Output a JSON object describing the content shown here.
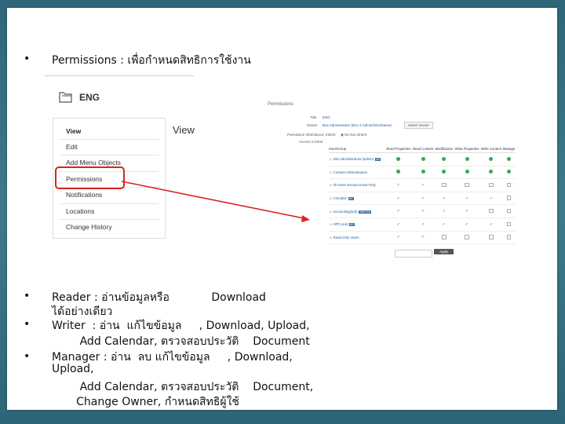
{
  "bullets": {
    "b1": "Permissions : เพื่อกำหนดสิทธิการใช้งาน",
    "b2_l1": "Reader : อ่านข้อมูลหรือ            Download",
    "b2_l2": "ได้อย่างเดียว",
    "b3_l1": "Writer  : อ่าน  แก้ไขข้อมูล     , Download, Upload,",
    "b3_l2": "        Add Calendar, ตรวจสอบประวัติ    Document",
    "b4_l1": "Manager : อ่าน  ลบ แก้ไขข้อมูล     , Download,",
    "b4_l2": "Upload,",
    "b4_l3": "        Add Calendar, ตรวจสอบประวัติ    Document,",
    "b4_l4": "       Change Owner, กำหนดสิทธิผู้ใช้"
  },
  "folder": {
    "name": "ENG"
  },
  "menu": {
    "title": "View",
    "items": [
      "Edit",
      "Add Menu Objects",
      "Permissions",
      "Notifications",
      "Locations",
      "Change History"
    ]
  },
  "view_heading": "View",
  "panel": {
    "title": "Permissions",
    "row1_label": "Title",
    "row1_value": "ENG",
    "row2_label": "Owner",
    "row2_value": "Box Administrator (Box 2 Admin/Shortname)",
    "row2_btn": "Select Owner",
    "row3_label": "Permission Inheritance",
    "row3_opt1": "Inherit",
    "row3_opt2": "Do Not Inherit",
    "row4_label": "Access Control",
    "columns": [
      "User/Group",
      "Read Properties",
      "Read Content",
      "Modification",
      "Write Properties",
      "Write Content",
      "Manage"
    ],
    "rows": [
      {
        "name": "Site Administrators (admin)",
        "tag": "AD",
        "cells": [
          "g",
          "g",
          "g",
          "g",
          "g",
          "g"
        ]
      },
      {
        "name": "Content Administrators",
        "tag": "",
        "cells": [
          "g",
          "g",
          "g",
          "g",
          "g",
          "g"
        ]
      },
      {
        "name": "All Users Except Guest-Only",
        "tag": "",
        "cells": [
          "t",
          "t",
          "b",
          "b",
          "b",
          "b"
        ]
      },
      {
        "name": "CSCabin",
        "tag": "AD",
        "cells": [
          "t",
          "t",
          "t",
          "t",
          "t",
          "b"
        ]
      },
      {
        "name": "Accounting(sub)",
        "tag": "WRITER",
        "cells": [
          "t",
          "t",
          "t",
          "t",
          "b",
          "b"
        ]
      },
      {
        "name": "HPF prod",
        "tag": "AD",
        "cells": [
          "t",
          "t",
          "t",
          "t",
          "t",
          "b"
        ]
      },
      {
        "name": "Read-Only Users",
        "tag": "",
        "cells": [
          "t",
          "t",
          "b",
          "b",
          "b",
          "b"
        ]
      }
    ],
    "footer_btn": "Apply"
  }
}
